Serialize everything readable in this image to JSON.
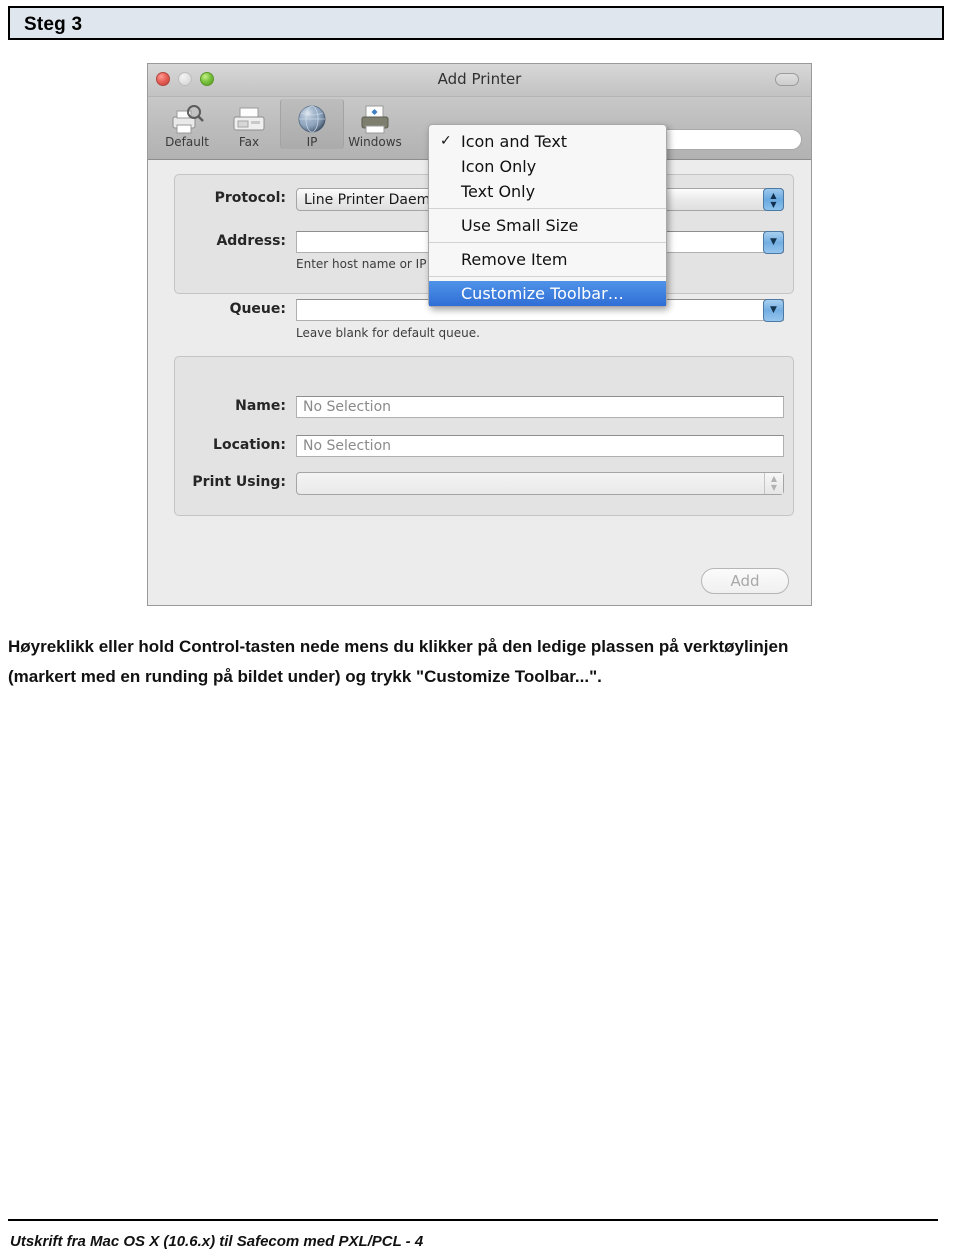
{
  "page": {
    "step_banner": "Steg 3",
    "instruction_line1": "Høyreklikk eller hold Control-tasten nede mens du klikker på den ledige plassen på verktøylinjen",
    "instruction_line2": "(markert med en runding på bildet under) og trykk \"Customize Toolbar...\".",
    "footer": "Utskrift fra Mac OS X (10.6.x) til Safecom med PXL/PCL - 4"
  },
  "screenshot": {
    "window": {
      "title": "Add Printer",
      "traffic_lights": {
        "close": "close-button",
        "minimize": "minimize-button",
        "zoom": "zoom-button"
      },
      "toolbar_toggle": "toolbar-toggle-button"
    },
    "toolbar": {
      "items": [
        {
          "label": "Default",
          "icon": "printer-magnifier-icon",
          "selected": false
        },
        {
          "label": "Fax",
          "icon": "fax-machine-icon",
          "selected": false
        },
        {
          "label": "IP",
          "icon": "globe-icon",
          "selected": true
        },
        {
          "label": "Windows",
          "icon": "network-printer-icon",
          "selected": false
        }
      ],
      "search_placeholder": "",
      "search_value": "",
      "search_icon": "search-icon"
    },
    "form": {
      "protocol": {
        "label": "Protocol:",
        "value": "Line Printer Daemon - LPD",
        "control": "popup-button"
      },
      "address": {
        "label": "Address:",
        "value": "",
        "hint": "Enter host name or IP address.",
        "control": "combo-box"
      },
      "queue": {
        "label": "Queue:",
        "value": "",
        "hint": "Leave blank for default queue.",
        "control": "combo-box"
      },
      "name": {
        "label": "Name:",
        "value": "No Selection"
      },
      "location": {
        "label": "Location:",
        "value": "No Selection"
      },
      "print_using": {
        "label": "Print Using:",
        "value": "",
        "control": "popup-button",
        "disabled": true
      }
    },
    "add_button": "Add",
    "context_menu": {
      "items": [
        {
          "label": "Icon and Text",
          "checked": true,
          "highlighted": false,
          "separator_after": false
        },
        {
          "label": "Icon Only",
          "checked": false,
          "highlighted": false,
          "separator_after": false
        },
        {
          "label": "Text Only",
          "checked": false,
          "highlighted": false,
          "separator_after": true
        },
        {
          "label": "Use Small Size",
          "checked": false,
          "highlighted": false,
          "separator_after": true
        },
        {
          "label": "Remove Item",
          "checked": false,
          "highlighted": false,
          "separator_after": true
        },
        {
          "label": "Customize Toolbar…",
          "checked": false,
          "highlighted": true,
          "separator_after": false
        }
      ],
      "checkmark_glyph": "✓"
    }
  },
  "colors": {
    "banner_bg": "#dfe6ee",
    "menu_highlight": "#2f6ed6",
    "window_bg": "#ececec"
  }
}
